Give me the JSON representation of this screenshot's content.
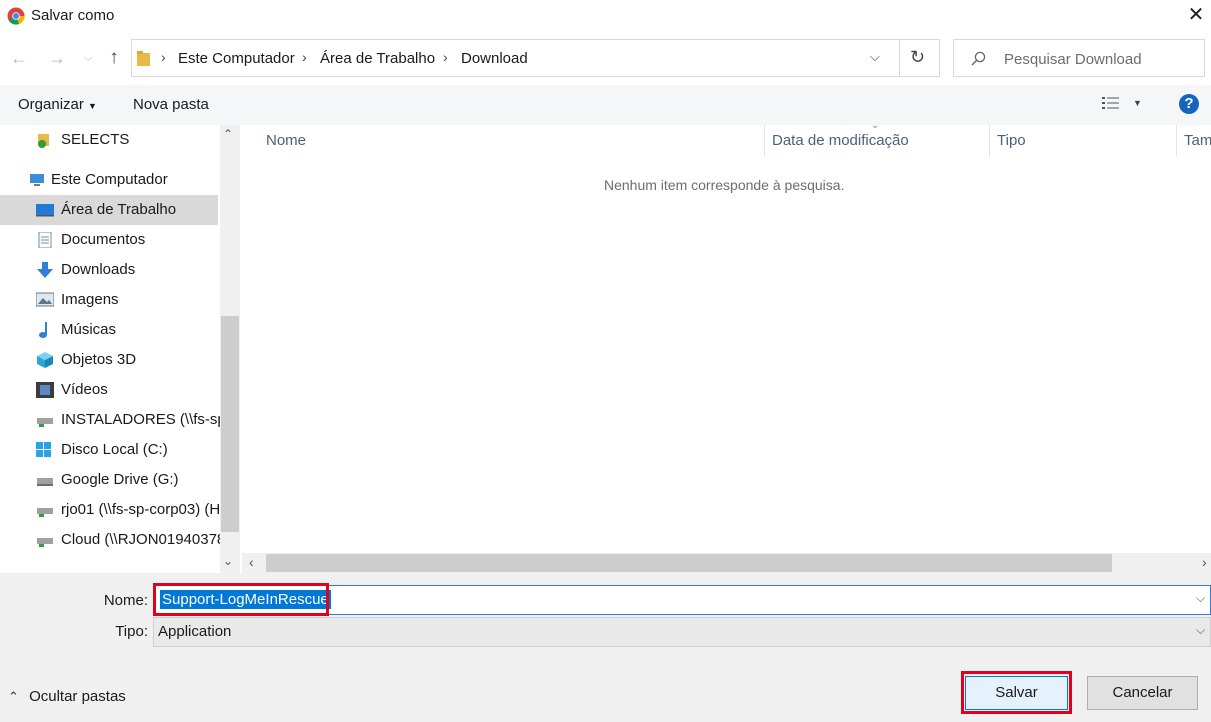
{
  "window": {
    "title": "Salvar como"
  },
  "address": {
    "crumbs": [
      "Este Computador",
      "Área de Trabalho",
      "Download"
    ]
  },
  "search": {
    "placeholder": "Pesquisar Download"
  },
  "toolbar": {
    "organize": "Organizar",
    "new_folder": "Nova pasta",
    "help": "?"
  },
  "sidebar": {
    "items": [
      {
        "label": "SELECTS",
        "icon": "shared-folder-icon"
      },
      {
        "label": "Este Computador",
        "icon": "computer-icon"
      },
      {
        "label": "Área de Trabalho",
        "icon": "desktop-icon",
        "selected": true
      },
      {
        "label": "Documentos",
        "icon": "documents-icon"
      },
      {
        "label": "Downloads",
        "icon": "downloads-icon"
      },
      {
        "label": "Imagens",
        "icon": "pictures-icon"
      },
      {
        "label": "Músicas",
        "icon": "music-icon"
      },
      {
        "label": "Objetos 3D",
        "icon": "3d-objects-icon"
      },
      {
        "label": "Vídeos",
        "icon": "videos-icon"
      },
      {
        "label": "INSTALADORES (\\\\fs-sp",
        "icon": "network-drive-icon"
      },
      {
        "label": "Disco Local (C:)",
        "icon": "local-disk-icon"
      },
      {
        "label": "Google Drive (G:)",
        "icon": "drive-icon"
      },
      {
        "label": "rjo01 (\\\\fs-sp-corp03) (H",
        "icon": "network-drive-icon"
      },
      {
        "label": "Cloud (\\\\RJON01940378",
        "icon": "network-drive-icon"
      }
    ]
  },
  "file_list": {
    "columns": [
      "Nome",
      "Data de modificação",
      "Tipo",
      "Tam"
    ],
    "empty_message": "Nenhum item corresponde à pesquisa."
  },
  "form": {
    "name_label": "Nome:",
    "name_value": "Support-LogMeInRescue",
    "type_label": "Tipo:",
    "type_value": "Application"
  },
  "footer": {
    "hide_folders": "Ocultar pastas",
    "save": "Salvar",
    "cancel": "Cancelar"
  },
  "colors": {
    "highlight": "#e2001a",
    "selection": "#0078d7",
    "help": "#1565c0"
  }
}
